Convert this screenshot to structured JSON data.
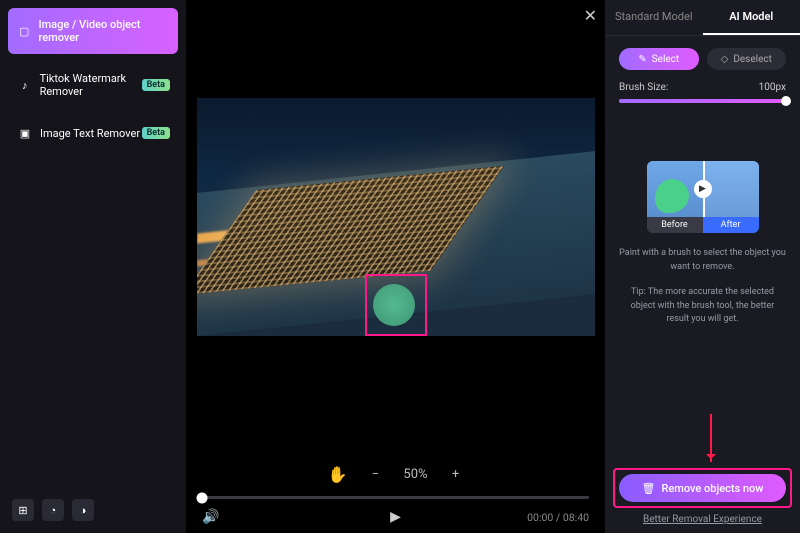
{
  "sidebar": {
    "items": [
      {
        "label": "Image / Video object remover"
      },
      {
        "label": "Tiktok Watermark Remover",
        "badge": "Beta"
      },
      {
        "label": "Image Text Remover",
        "badge": "Beta"
      }
    ]
  },
  "zoom": {
    "value": "50%"
  },
  "player": {
    "time": "00:00 / 08:40"
  },
  "right": {
    "tabs": {
      "standard": "Standard Model",
      "ai": "AI Model"
    },
    "select_label": "Select",
    "deselect_label": "Deselect",
    "brush_label": "Brush Size:",
    "brush_value": "100px",
    "preview": {
      "before": "Before",
      "after": "After"
    },
    "tip1": "Paint with a brush to select the object you want to remove.",
    "tip2": "Tip: The more accurate the selected object with the brush tool, the better result you will get.",
    "cta": "Remove objects now",
    "link": "Better Removal Experience"
  }
}
